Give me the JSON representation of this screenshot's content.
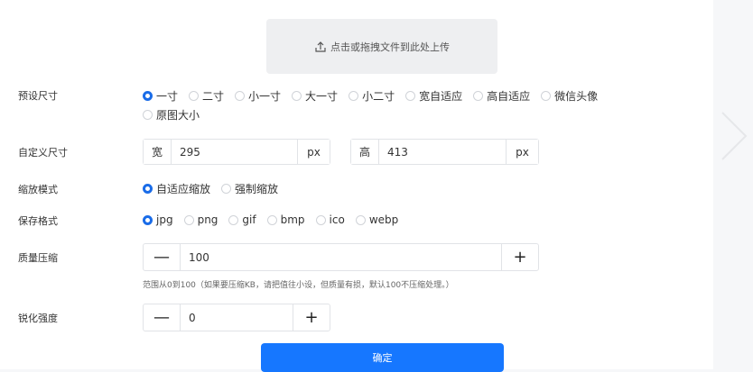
{
  "upload": {
    "label": "点击或拖拽文件到此处上传",
    "icon": "upload-icon"
  },
  "preset_size": {
    "label": "预设尺寸",
    "options": [
      "一寸",
      "二寸",
      "小一寸",
      "大一寸",
      "小二寸",
      "宽自适应",
      "高自适应",
      "微信头像",
      "原图大小"
    ],
    "selected": "一寸"
  },
  "custom_size": {
    "label": "自定义尺寸",
    "width_prefix": "宽",
    "width_value": "295",
    "width_unit": "px",
    "height_prefix": "高",
    "height_value": "413",
    "height_unit": "px"
  },
  "scale_mode": {
    "label": "缩放模式",
    "options": [
      "自适应缩放",
      "强制缩放"
    ],
    "selected": "自适应缩放"
  },
  "save_format": {
    "label": "保存格式",
    "options": [
      "jpg",
      "png",
      "gif",
      "bmp",
      "ico",
      "webp"
    ],
    "selected": "jpg"
  },
  "quality": {
    "label": "质量压缩",
    "minus": "—",
    "value": "100",
    "plus": "+",
    "hint": "范围从0到100（如果要压缩KB，请把值往小设，但质量有损，默认100不压缩处理。）"
  },
  "sharpen": {
    "label": "锐化强度",
    "minus": "—",
    "value": "0",
    "plus": "+"
  },
  "confirm_label": "确定",
  "colors": {
    "accent": "#1677ff",
    "radio_checked": "#1a6ce8",
    "border": "#e1e3e7"
  }
}
